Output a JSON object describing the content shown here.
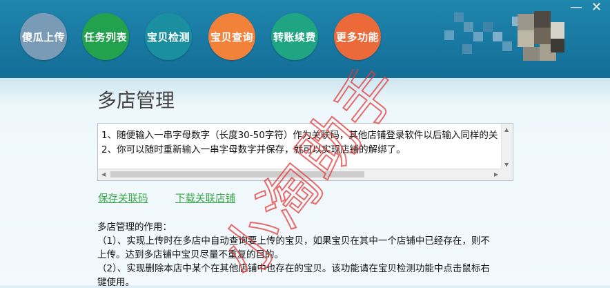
{
  "toolbar": {
    "buttons": [
      {
        "label": "傻瓜上传",
        "color": "#7a9bb5"
      },
      {
        "label": "任务列表",
        "color": "#23a24d"
      },
      {
        "label": "宝贝检测",
        "color": "#1a8fa0"
      },
      {
        "label": "宝贝查询",
        "color": "#f2813a"
      },
      {
        "label": "转账续费",
        "color": "#1fa582"
      },
      {
        "label": "更多功能",
        "color": "#ec6a3a"
      }
    ]
  },
  "window": {
    "minimize": "—",
    "close": "✕"
  },
  "page": {
    "title": "多店管理",
    "textbox_lines": [
      "1、随便输入一串字母数字（长度30-50字符）作为关联码，其他店铺登录软件以后输入同样的关",
      "2、你可以随时重新输入一串字母数字并保存，就可以实现店铺的解绑了。"
    ],
    "links": {
      "save": "保存关联码",
      "download": "下载关联店铺"
    },
    "description": [
      "多店管理的作用：",
      "（1）、实现上传时在多店中自动查询要上传的宝贝，如果宝贝在其中一个店铺中已经存在，则不",
      "上传。达到多店铺中宝贝尽量不重复的目的。",
      "（2）、实现删除本店中某个在其他店铺中也存在的宝贝。该功能请在宝贝检测功能中点击鼠标右",
      "键使用。"
    ]
  },
  "watermark": {
    "text": "小淘助手",
    "color": "#e23b3b"
  }
}
